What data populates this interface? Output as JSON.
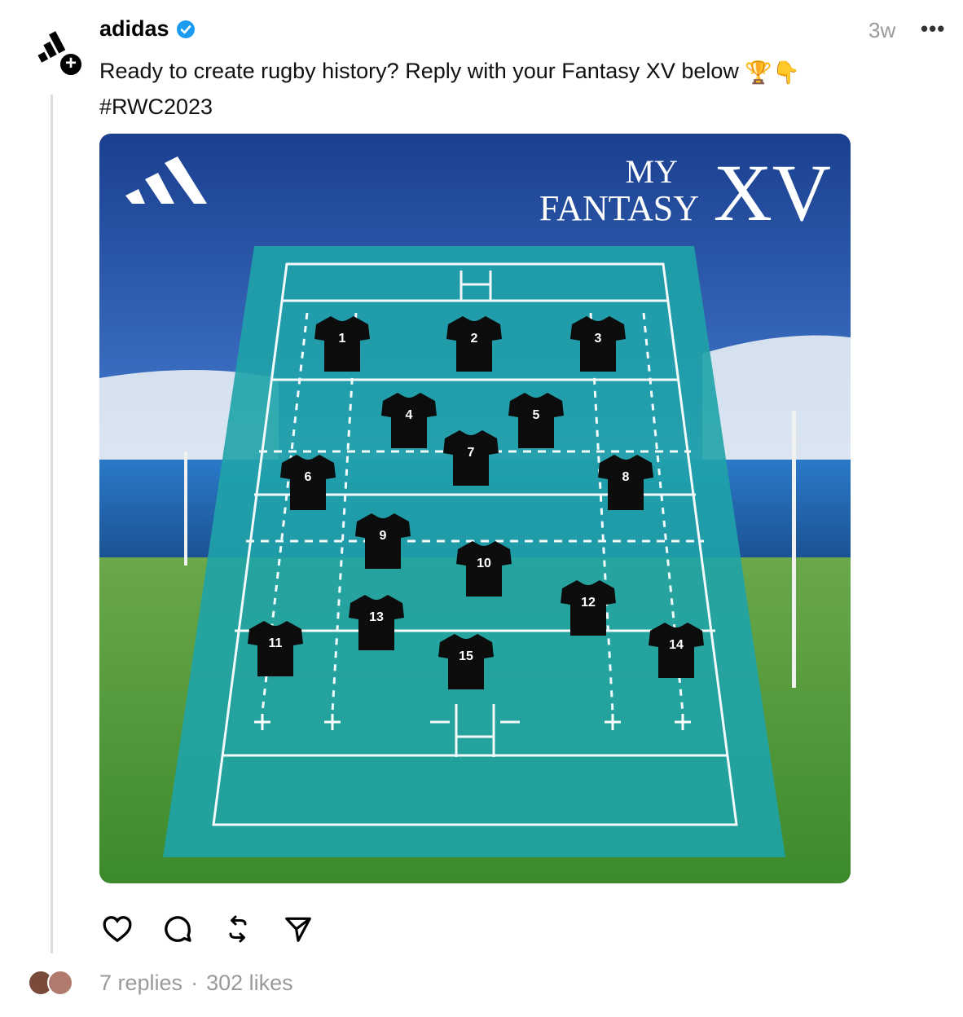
{
  "post": {
    "username": "adidas",
    "verified": true,
    "time_ago": "3w",
    "more_label": "•••",
    "caption_line1": "Ready to create rugby history? Reply with your Fantasy XV below",
    "caption_emoji": [
      "🏆",
      "👇"
    ],
    "caption_line2": "#RWC2023"
  },
  "image": {
    "title_my": "MY",
    "title_fantasy": "FANTASY",
    "title_xv": "XV",
    "players": [
      "1",
      "2",
      "3",
      "4",
      "5",
      "6",
      "7",
      "8",
      "9",
      "10",
      "11",
      "12",
      "13",
      "14",
      "15"
    ]
  },
  "actions": {
    "like_icon": "heart-icon",
    "reply_icon": "comment-icon",
    "repost_icon": "repost-icon",
    "share_icon": "send-icon"
  },
  "footer": {
    "replies": "7 replies",
    "separator": "·",
    "likes": "302 likes"
  },
  "colors": {
    "accent_verified": "#1d9bf0",
    "pitch_teal": "#1fa3a8",
    "sky_top": "#1b3f8f"
  }
}
